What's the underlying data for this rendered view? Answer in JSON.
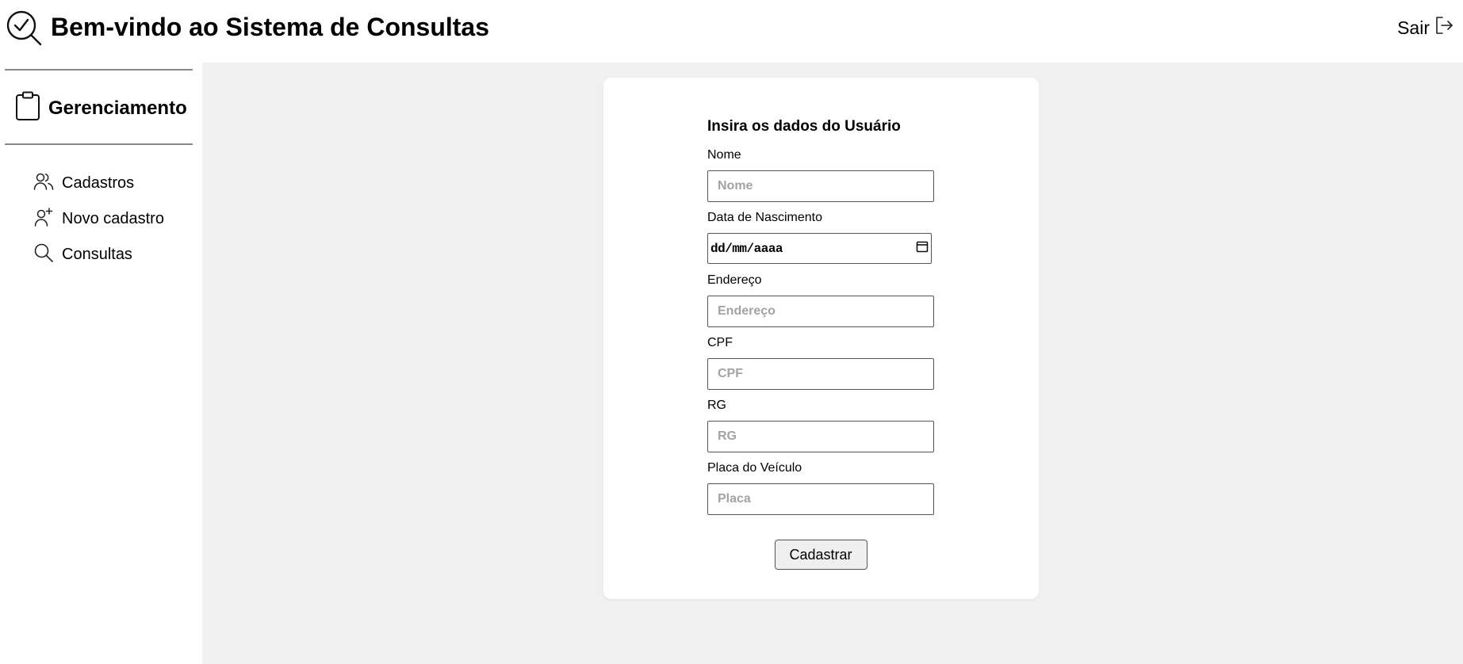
{
  "header": {
    "title": "Bem-vindo ao Sistema de Consultas",
    "logout_label": "Sair",
    "logo_icon": "search-check-icon",
    "logout_icon": "logout-icon"
  },
  "sidebar": {
    "section_title": "Gerenciamento",
    "section_icon": "clipboard-icon",
    "items": [
      {
        "label": "Cadastros",
        "icon": "users-icon"
      },
      {
        "label": "Novo cadastro",
        "icon": "user-plus-icon"
      },
      {
        "label": "Consultas",
        "icon": "search-icon"
      }
    ]
  },
  "form": {
    "heading": "Insira os dados do Usuário",
    "fields": {
      "nome": {
        "label": "Nome",
        "placeholder": "Nome",
        "value": ""
      },
      "nascimento": {
        "label": "Data de Nascimento",
        "value": "dd/mm/aaaa"
      },
      "endereco": {
        "label": "Endereço",
        "placeholder": "Endereço",
        "value": ""
      },
      "cpf": {
        "label": "CPF",
        "placeholder": "CPF",
        "value": ""
      },
      "rg": {
        "label": "RG",
        "placeholder": "RG",
        "value": ""
      },
      "placa": {
        "label": "Placa do Veículo",
        "placeholder": "Placa",
        "value": ""
      }
    },
    "submit_label": "Cadastrar"
  },
  "colors": {
    "page_background": "#ffffff",
    "main_background": "#f0f0f0",
    "card_background": "#ffffff",
    "placeholder": "#a3a3a3",
    "button_background": "#efefef"
  }
}
